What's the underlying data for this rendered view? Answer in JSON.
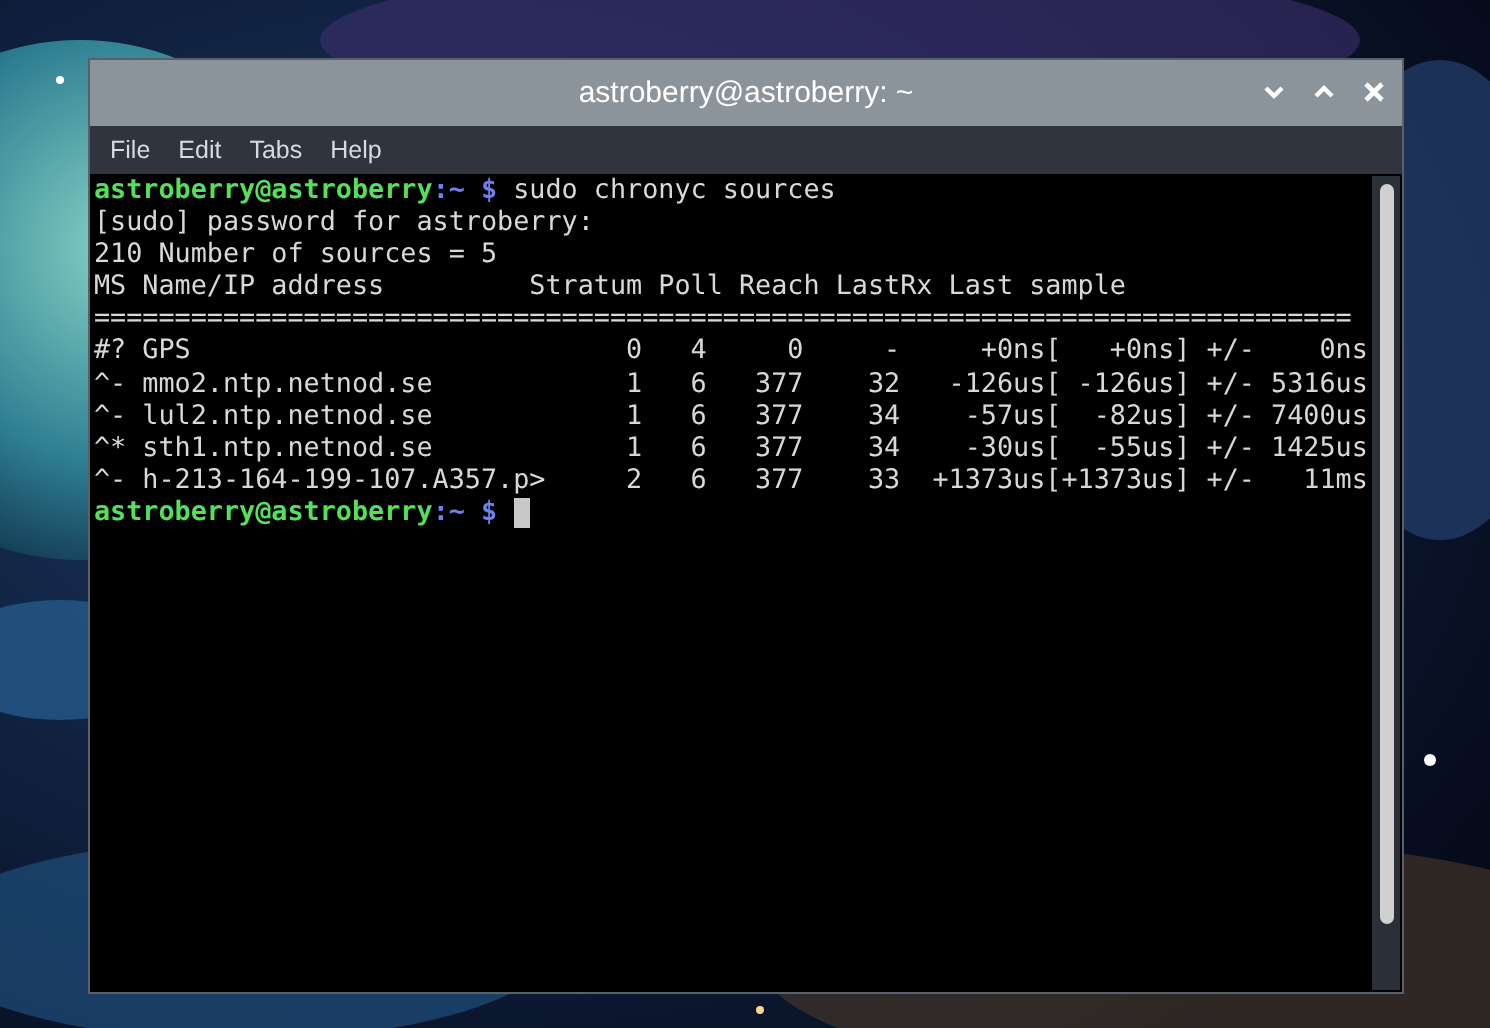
{
  "window": {
    "title": "astroberry@astroberry: ~"
  },
  "menu": [
    "File",
    "Edit",
    "Tabs",
    "Help"
  ],
  "terminal": {
    "lines": [
      {
        "kind": "prompt",
        "user": "astroberry@astroberry",
        "path": ":~",
        "symbol": "$",
        "command": "sudo chronyc sources",
        "cursor": false
      },
      {
        "kind": "output",
        "text": "[sudo] password for astroberry:"
      },
      {
        "kind": "output",
        "text": "210 Number of sources = 5"
      },
      {
        "kind": "output",
        "text": "MS Name/IP address         Stratum Poll Reach LastRx Last sample"
      },
      {
        "kind": "output",
        "text": "=============================================================================="
      },
      {
        "kind": "output",
        "text": "#? GPS                           0   4     0     -     +0ns[   +0ns] +/-    0ns"
      },
      {
        "kind": "output",
        "text": "^- mmo2.ntp.netnod.se            1   6   377    32   -126us[ -126us] +/- 5316us"
      },
      {
        "kind": "output",
        "text": "^- lul2.ntp.netnod.se            1   6   377    34    -57us[  -82us] +/- 7400us"
      },
      {
        "kind": "output",
        "text": "^* sth1.ntp.netnod.se            1   6   377    34    -30us[  -55us] +/- 1425us"
      },
      {
        "kind": "output",
        "text": "^- h-213-164-199-107.A357.p>     2   6   377    33  +1373us[+1373us] +/-   11ms"
      },
      {
        "kind": "prompt",
        "user": "astroberry@astroberry",
        "path": ":~",
        "symbol": "$",
        "cursor": true
      }
    ]
  }
}
